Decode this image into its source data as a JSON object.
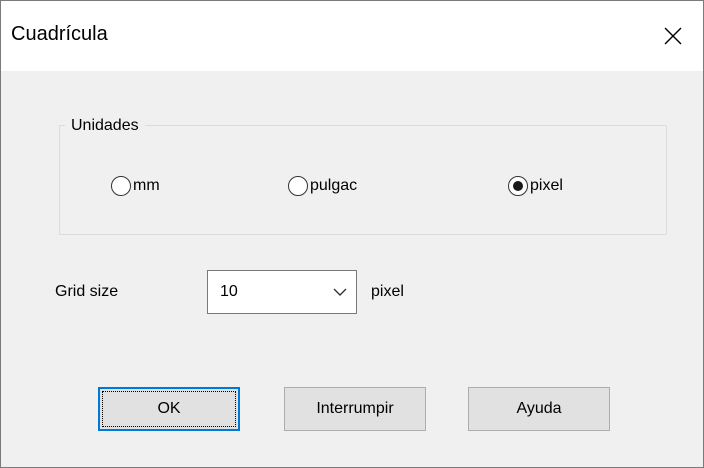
{
  "window": {
    "title": "Cuadrícula",
    "close_icon": "close-icon"
  },
  "units_group": {
    "label": "Unidades",
    "options": [
      {
        "label": "mm",
        "checked": false
      },
      {
        "label": "pulgac",
        "checked": false
      },
      {
        "label": "pixel",
        "checked": true
      }
    ]
  },
  "grid_size": {
    "label": "Grid size",
    "value": "10",
    "unit": "pixel"
  },
  "buttons": {
    "ok": "OK",
    "cancel": "Interrumpir",
    "help": "Ayuda"
  },
  "colors": {
    "focus_border": "#0078d7",
    "button_bg": "#e1e1e1",
    "dialog_bg": "#f0f0f0"
  }
}
